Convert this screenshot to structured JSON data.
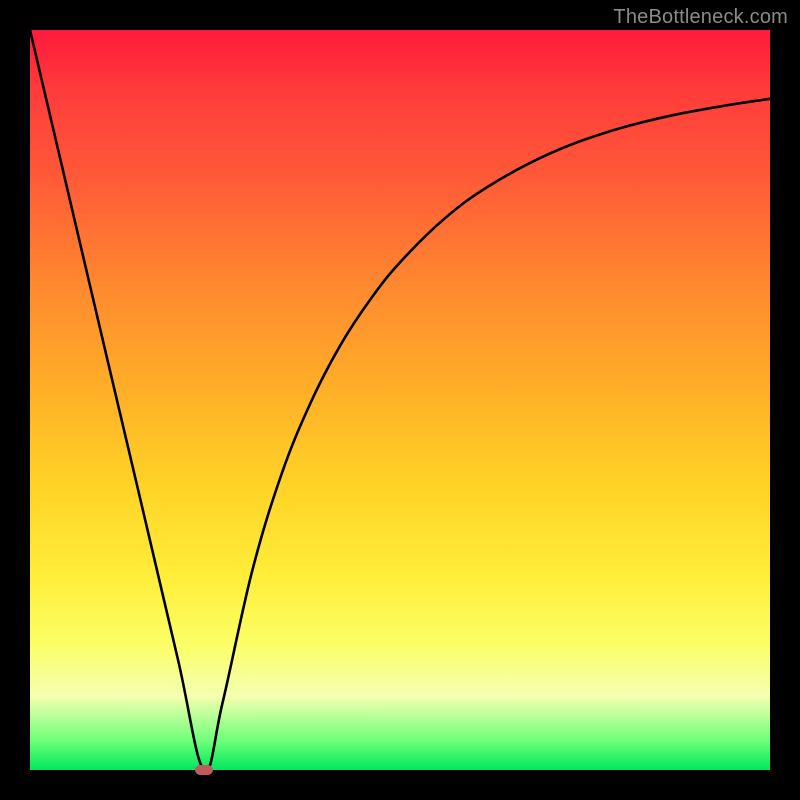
{
  "watermark": {
    "text": "TheBottleneck.com"
  },
  "chart_data": {
    "type": "line",
    "title": "",
    "xlabel": "",
    "ylabel": "",
    "xlim": [
      0,
      1
    ],
    "ylim": [
      0,
      1
    ],
    "grid": false,
    "legend": false,
    "marker": {
      "x": 0.235,
      "y": 0.0,
      "color": "#c15a5a"
    },
    "series": [
      {
        "name": "curve",
        "x": [
          0.0,
          0.05,
          0.1,
          0.15,
          0.2,
          0.235,
          0.26,
          0.3,
          0.34,
          0.38,
          0.42,
          0.46,
          0.5,
          0.56,
          0.62,
          0.7,
          0.78,
          0.86,
          0.94,
          1.0
        ],
        "y": [
          1.0,
          0.787,
          0.574,
          0.362,
          0.149,
          0.0,
          0.09,
          0.268,
          0.4,
          0.498,
          0.575,
          0.636,
          0.686,
          0.745,
          0.789,
          0.832,
          0.862,
          0.883,
          0.898,
          0.907
        ]
      }
    ],
    "background_gradient": {
      "direction": "vertical",
      "stops": [
        {
          "pos": 0.0,
          "color": "#ff1a3c"
        },
        {
          "pos": 0.5,
          "color": "#ffb327"
        },
        {
          "pos": 0.83,
          "color": "#fbff66"
        },
        {
          "pos": 1.0,
          "color": "#00e85c"
        }
      ]
    }
  }
}
